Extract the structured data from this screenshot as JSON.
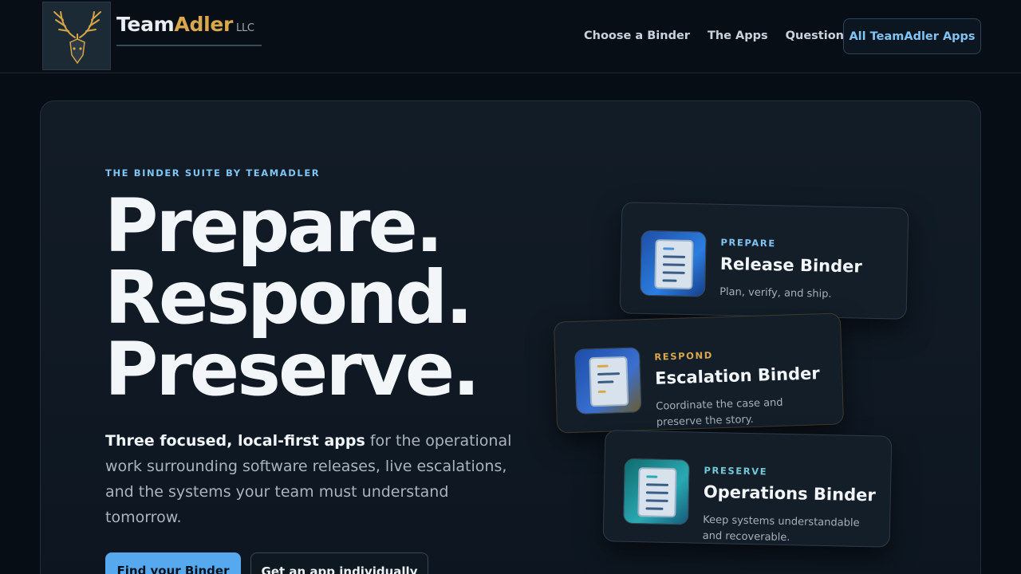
{
  "brand": {
    "name_part1": "Team",
    "name_part2": "Adler",
    "suffix": "LLC"
  },
  "nav": {
    "items": [
      "Choose a Binder",
      "The Apps",
      "Questions"
    ],
    "cta": "All TeamAdler Apps"
  },
  "hero": {
    "eyebrow": "THE BINDER SUITE BY TEAMADLER",
    "headline": [
      "Prepare.",
      "Respond.",
      "Preserve."
    ],
    "lede_strong": "Three focused, local-first apps",
    "lede_rest": " for the operational work surrounding software releases, live escalations, and the systems your team must understand tomorrow.",
    "primary_button": "Find your Binder",
    "secondary_button": "Get an app individually"
  },
  "cards": [
    {
      "tag": "PREPARE",
      "title": "Release Binder",
      "desc": "Plan, verify, and ship.",
      "icon": "checklist-icon",
      "accent": "#7fc4f5"
    },
    {
      "tag": "RESPOND",
      "title": "Escalation Binder",
      "desc": "Coordinate the case and preserve the story.",
      "icon": "escalation-icon",
      "accent": "#d9a84a"
    },
    {
      "tag": "PRESERVE",
      "title": "Operations Binder",
      "desc": "Keep systems understandable and recoverable.",
      "icon": "operations-icon",
      "accent": "#74c8d6"
    }
  ],
  "colors": {
    "background": "#070d14",
    "accent_blue": "#57a9ef",
    "accent_gold": "#d9a84a"
  }
}
